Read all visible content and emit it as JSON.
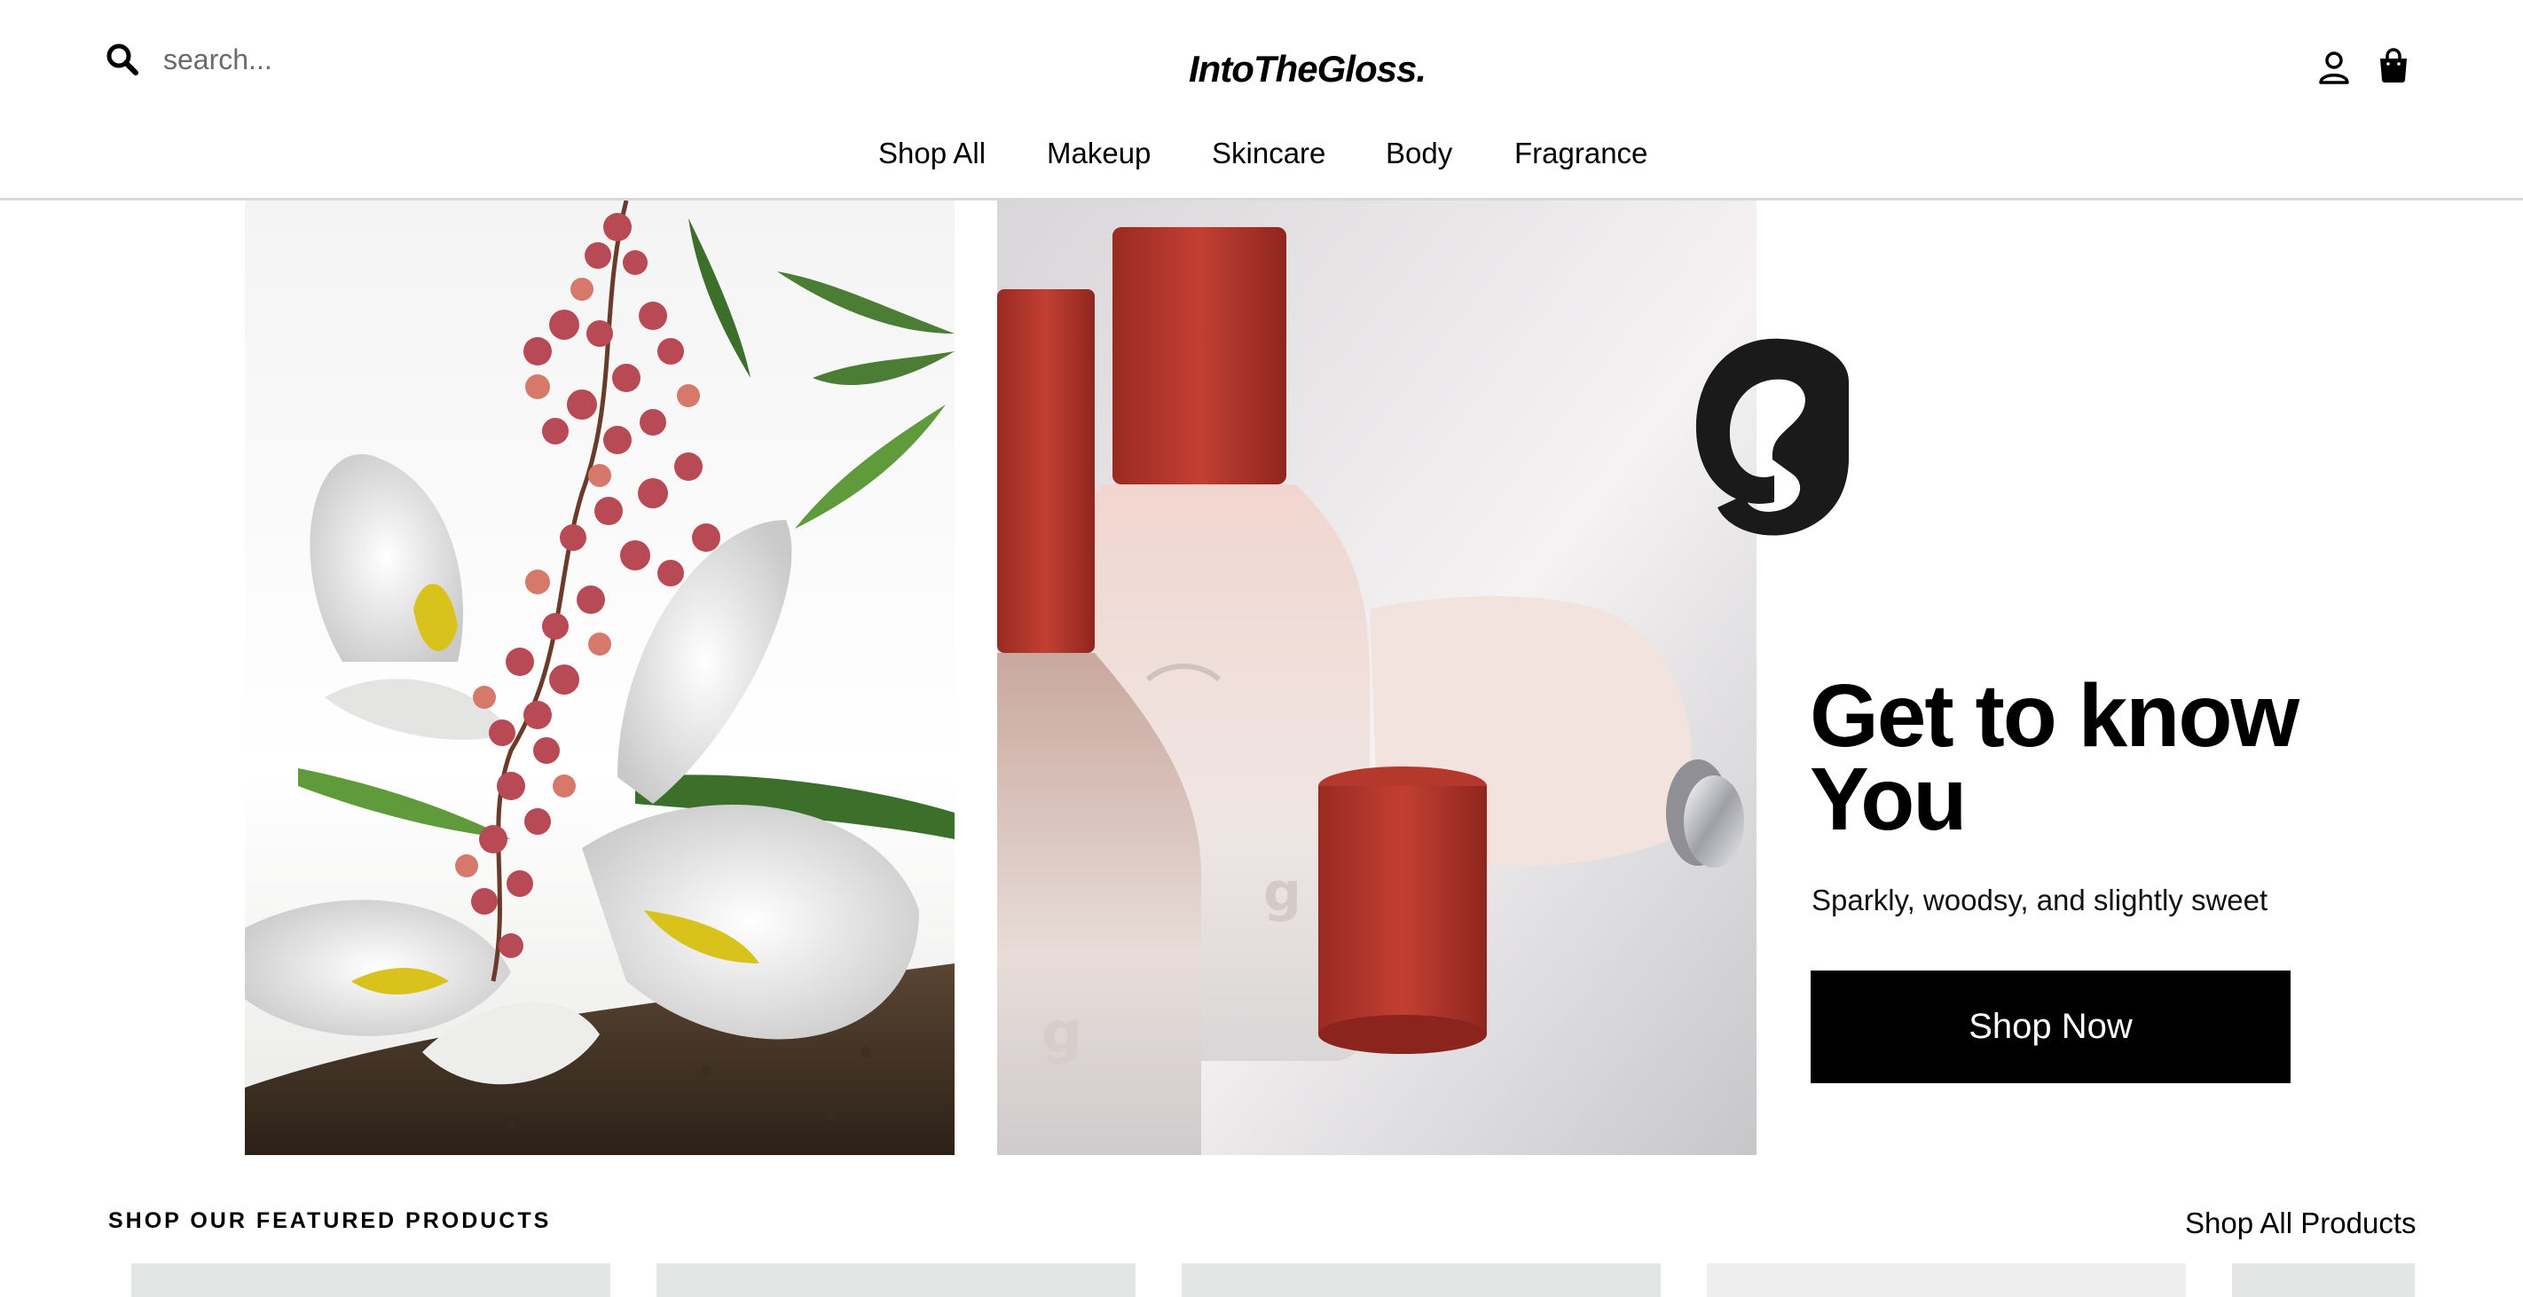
{
  "header": {
    "search_placeholder": "search...",
    "logo": "IntoTheGloss.",
    "icons": [
      "search-icon",
      "account-icon",
      "shopping-bag-icon"
    ]
  },
  "nav": {
    "items": [
      "Shop All",
      "Makeup",
      "Skincare",
      "Body",
      "Fragrance"
    ]
  },
  "hero": {
    "title": "Get to know You",
    "subtitle": "Sparkly, woodsy, and slightly sweet",
    "cta": "Shop Now",
    "images": [
      "flower-branch-image",
      "perfume-bottles-image"
    ],
    "brand_mark_icon": "glossier-g-icon"
  },
  "featured": {
    "heading": "SHOP OUR FEATURED PRODUCTS",
    "link": "Shop All Products"
  },
  "colors": {
    "background": "#ffffff",
    "button": "#000000",
    "button_text": "#ffffff",
    "divider": "#d9d9d9",
    "card_placeholder": "#e4e6e6",
    "bottle_cap": "#b8352a"
  }
}
